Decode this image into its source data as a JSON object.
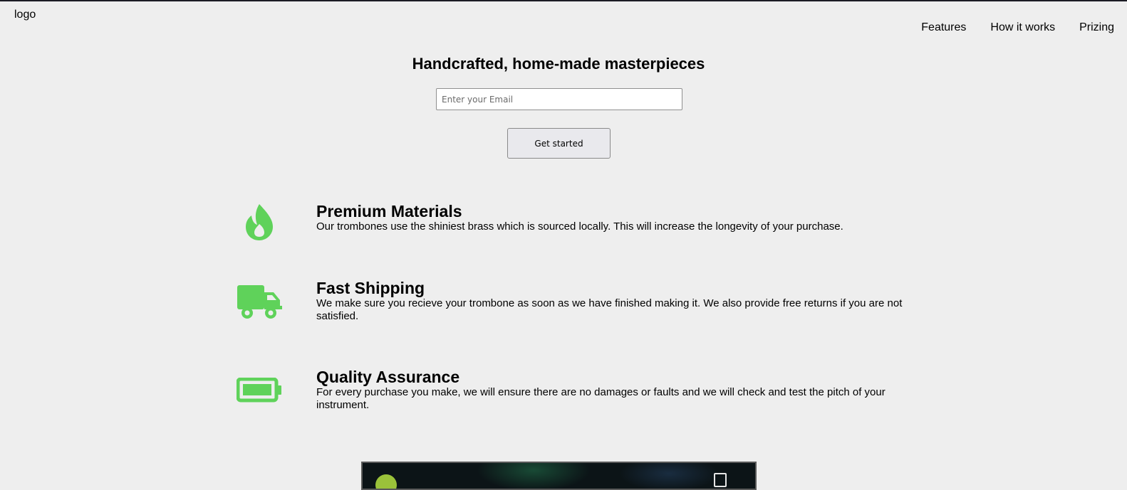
{
  "header": {
    "logo": "logo",
    "nav": [
      {
        "label": "Features"
      },
      {
        "label": "How it works"
      },
      {
        "label": "Prizing"
      }
    ]
  },
  "hero": {
    "title": "Handcrafted, home-made masterpieces",
    "email_placeholder": "Enter your Email",
    "button_label": "Get started"
  },
  "features": [
    {
      "icon": "fire-icon",
      "title": "Premium Materials",
      "description": "Our trombones use the shiniest brass which is sourced locally. This will increase the longevity of your purchase."
    },
    {
      "icon": "truck-icon",
      "title": "Fast Shipping",
      "description": "We make sure you recieve your trombone as soon as we have finished making it. We also provide free returns if you are not satisfied."
    },
    {
      "icon": "battery-full-icon",
      "title": "Quality Assurance",
      "description": "For every purchase you make, we will ensure there are no damages or faults and we will check and test the pitch of your instrument."
    }
  ],
  "colors": {
    "background": "#eeeeee",
    "icon_green": "#5fd25a"
  }
}
